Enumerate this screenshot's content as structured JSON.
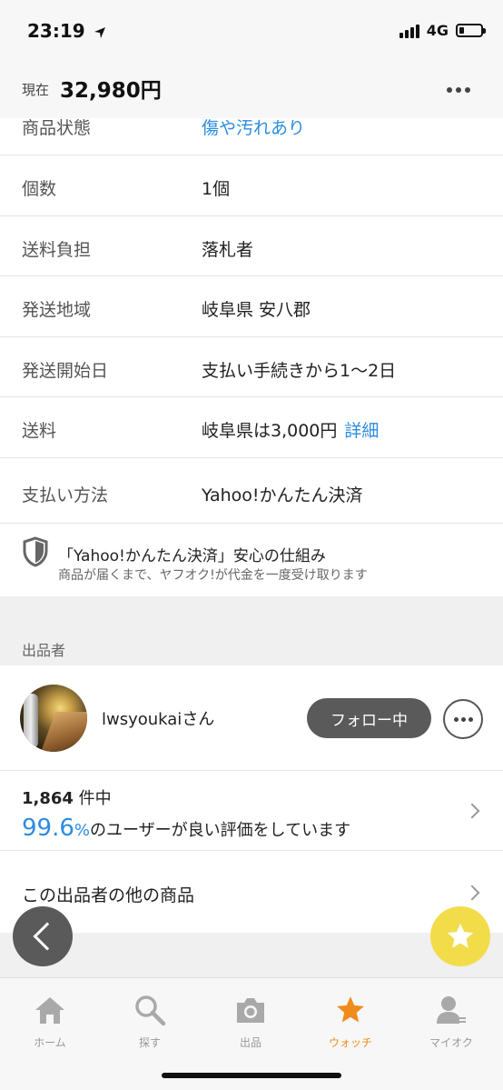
{
  "status_bar": {
    "time": "23:19",
    "network": "4G"
  },
  "header": {
    "price_prefix": "現在",
    "price": "32,980円"
  },
  "details": [
    {
      "label": "商品状態",
      "value": "傷や汚れあり",
      "value_is_link": true
    },
    {
      "label": "個数",
      "value": "1個"
    },
    {
      "label": "送料負担",
      "value": "落札者"
    },
    {
      "label": "発送地域",
      "value": "岐阜県 安八郡"
    },
    {
      "label": "発送開始日",
      "value": "支払い手続きから1〜2日"
    },
    {
      "label": "送料",
      "value": "岐阜県は3,000円",
      "link": "詳細"
    },
    {
      "label": "支払い方法",
      "value": "Yahoo!かんたん決済"
    }
  ],
  "assurance": {
    "title": "「Yahoo!かんたん決済」安心の仕組み",
    "description": "商品が届くまで、ヤフオク!が代金を一度受け取ります"
  },
  "seller_section": {
    "label": "出品者",
    "name": "lwsyoukaiさん",
    "follow_label": "フォロー中"
  },
  "rating": {
    "count": "1,864",
    "count_suffix": " 件中",
    "percent": "99.6",
    "percent_unit": "%",
    "text": "のユーザーが良い評価をしています"
  },
  "other_items": {
    "label": "この出品者の他の商品"
  },
  "tabs": [
    {
      "label": "ホーム",
      "icon": "home-icon",
      "active": false
    },
    {
      "label": "探す",
      "icon": "search-icon",
      "active": false
    },
    {
      "label": "出品",
      "icon": "camera-icon",
      "active": false
    },
    {
      "label": "ウォッチ",
      "icon": "star-icon",
      "active": true
    },
    {
      "label": "マイオク",
      "icon": "user-icon",
      "active": false
    }
  ],
  "colors": {
    "link": "#2c8ce0",
    "active_tab": "#f08c1e",
    "star_fab": "#f2dc4a"
  }
}
